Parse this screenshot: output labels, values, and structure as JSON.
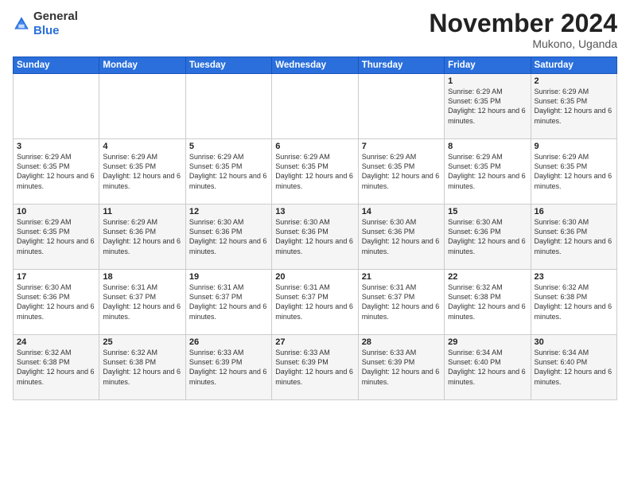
{
  "header": {
    "logo_general": "General",
    "logo_blue": "Blue",
    "month_title": "November 2024",
    "subtitle": "Mukono, Uganda"
  },
  "weekdays": [
    "Sunday",
    "Monday",
    "Tuesday",
    "Wednesday",
    "Thursday",
    "Friday",
    "Saturday"
  ],
  "weeks": [
    [
      {
        "day": "",
        "info": ""
      },
      {
        "day": "",
        "info": ""
      },
      {
        "day": "",
        "info": ""
      },
      {
        "day": "",
        "info": ""
      },
      {
        "day": "",
        "info": ""
      },
      {
        "day": "1",
        "info": "Sunrise: 6:29 AM\nSunset: 6:35 PM\nDaylight: 12 hours and 6 minutes."
      },
      {
        "day": "2",
        "info": "Sunrise: 6:29 AM\nSunset: 6:35 PM\nDaylight: 12 hours and 6 minutes."
      }
    ],
    [
      {
        "day": "3",
        "info": "Sunrise: 6:29 AM\nSunset: 6:35 PM\nDaylight: 12 hours and 6 minutes."
      },
      {
        "day": "4",
        "info": "Sunrise: 6:29 AM\nSunset: 6:35 PM\nDaylight: 12 hours and 6 minutes."
      },
      {
        "day": "5",
        "info": "Sunrise: 6:29 AM\nSunset: 6:35 PM\nDaylight: 12 hours and 6 minutes."
      },
      {
        "day": "6",
        "info": "Sunrise: 6:29 AM\nSunset: 6:35 PM\nDaylight: 12 hours and 6 minutes."
      },
      {
        "day": "7",
        "info": "Sunrise: 6:29 AM\nSunset: 6:35 PM\nDaylight: 12 hours and 6 minutes."
      },
      {
        "day": "8",
        "info": "Sunrise: 6:29 AM\nSunset: 6:35 PM\nDaylight: 12 hours and 6 minutes."
      },
      {
        "day": "9",
        "info": "Sunrise: 6:29 AM\nSunset: 6:35 PM\nDaylight: 12 hours and 6 minutes."
      }
    ],
    [
      {
        "day": "10",
        "info": "Sunrise: 6:29 AM\nSunset: 6:35 PM\nDaylight: 12 hours and 6 minutes."
      },
      {
        "day": "11",
        "info": "Sunrise: 6:29 AM\nSunset: 6:36 PM\nDaylight: 12 hours and 6 minutes."
      },
      {
        "day": "12",
        "info": "Sunrise: 6:30 AM\nSunset: 6:36 PM\nDaylight: 12 hours and 6 minutes."
      },
      {
        "day": "13",
        "info": "Sunrise: 6:30 AM\nSunset: 6:36 PM\nDaylight: 12 hours and 6 minutes."
      },
      {
        "day": "14",
        "info": "Sunrise: 6:30 AM\nSunset: 6:36 PM\nDaylight: 12 hours and 6 minutes."
      },
      {
        "day": "15",
        "info": "Sunrise: 6:30 AM\nSunset: 6:36 PM\nDaylight: 12 hours and 6 minutes."
      },
      {
        "day": "16",
        "info": "Sunrise: 6:30 AM\nSunset: 6:36 PM\nDaylight: 12 hours and 6 minutes."
      }
    ],
    [
      {
        "day": "17",
        "info": "Sunrise: 6:30 AM\nSunset: 6:36 PM\nDaylight: 12 hours and 6 minutes."
      },
      {
        "day": "18",
        "info": "Sunrise: 6:31 AM\nSunset: 6:37 PM\nDaylight: 12 hours and 6 minutes."
      },
      {
        "day": "19",
        "info": "Sunrise: 6:31 AM\nSunset: 6:37 PM\nDaylight: 12 hours and 6 minutes."
      },
      {
        "day": "20",
        "info": "Sunrise: 6:31 AM\nSunset: 6:37 PM\nDaylight: 12 hours and 6 minutes."
      },
      {
        "day": "21",
        "info": "Sunrise: 6:31 AM\nSunset: 6:37 PM\nDaylight: 12 hours and 6 minutes."
      },
      {
        "day": "22",
        "info": "Sunrise: 6:32 AM\nSunset: 6:38 PM\nDaylight: 12 hours and 6 minutes."
      },
      {
        "day": "23",
        "info": "Sunrise: 6:32 AM\nSunset: 6:38 PM\nDaylight: 12 hours and 6 minutes."
      }
    ],
    [
      {
        "day": "24",
        "info": "Sunrise: 6:32 AM\nSunset: 6:38 PM\nDaylight: 12 hours and 6 minutes."
      },
      {
        "day": "25",
        "info": "Sunrise: 6:32 AM\nSunset: 6:38 PM\nDaylight: 12 hours and 6 minutes."
      },
      {
        "day": "26",
        "info": "Sunrise: 6:33 AM\nSunset: 6:39 PM\nDaylight: 12 hours and 6 minutes."
      },
      {
        "day": "27",
        "info": "Sunrise: 6:33 AM\nSunset: 6:39 PM\nDaylight: 12 hours and 6 minutes."
      },
      {
        "day": "28",
        "info": "Sunrise: 6:33 AM\nSunset: 6:39 PM\nDaylight: 12 hours and 6 minutes."
      },
      {
        "day": "29",
        "info": "Sunrise: 6:34 AM\nSunset: 6:40 PM\nDaylight: 12 hours and 6 minutes."
      },
      {
        "day": "30",
        "info": "Sunrise: 6:34 AM\nSunset: 6:40 PM\nDaylight: 12 hours and 6 minutes."
      }
    ]
  ]
}
